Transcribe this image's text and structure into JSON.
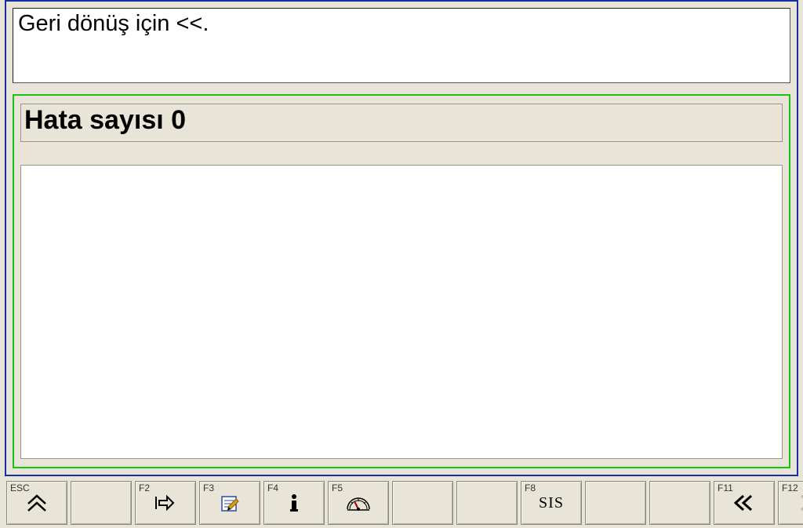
{
  "instruction_text": "Geri dönüş için <<.",
  "error_panel": {
    "title": "Hata sayısı 0"
  },
  "fkeys": {
    "esc": {
      "label": "ESC",
      "icon": "chevron-up-double-icon"
    },
    "f2": {
      "label": "F2",
      "icon": "enter-icon"
    },
    "f3": {
      "label": "F3",
      "icon": "edit-icon"
    },
    "f4": {
      "label": "F4",
      "icon": "info-icon"
    },
    "f5": {
      "label": "F5",
      "icon": "gauge-icon"
    },
    "f8": {
      "label": "F8",
      "text": "SIS"
    },
    "f11": {
      "label": "F11",
      "icon": "double-left-icon"
    },
    "f12": {
      "label": "F12",
      "icon": "double-right-icon",
      "disabled": true
    }
  }
}
